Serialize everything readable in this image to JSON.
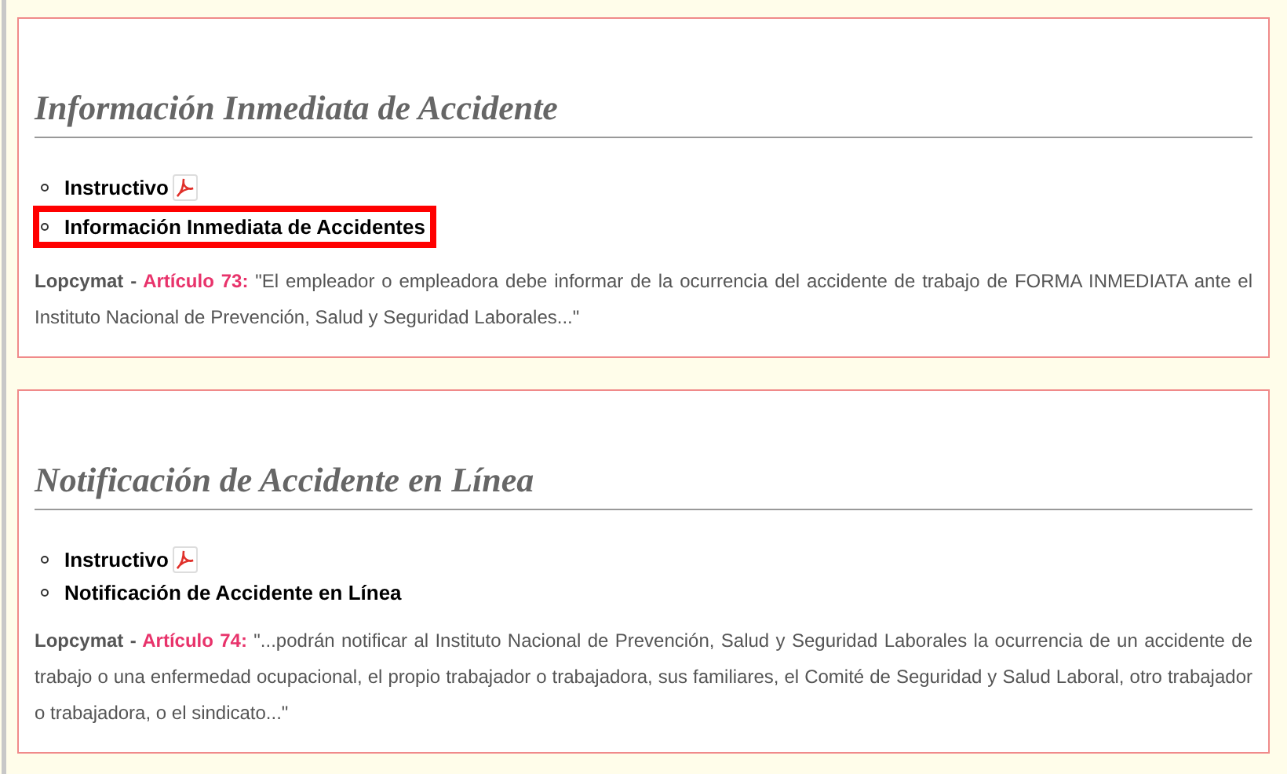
{
  "sections": [
    {
      "title": "Información Inmediata de Accidente",
      "links": [
        {
          "label": "Instructivo",
          "pdf": true,
          "highlighted": false
        },
        {
          "label": "Información Inmediata de Accidentes",
          "pdf": false,
          "highlighted": true
        }
      ],
      "source": "Lopcymat - ",
      "article": "Artículo 73:",
      "quote": " \"El empleador o empleadora debe informar de la ocurrencia del accidente de trabajo de FORMA INMEDIATA ante el Instituto Nacional de Prevención, Salud y Seguridad Laborales...\""
    },
    {
      "title": "Notificación de Accidente en Línea",
      "links": [
        {
          "label": "Instructivo",
          "pdf": true,
          "highlighted": false
        },
        {
          "label": "Notificación de Accidente en Línea",
          "pdf": false,
          "highlighted": false
        }
      ],
      "source": "Lopcymat - ",
      "article": "Artículo 74:",
      "quote": " \"...podrán notificar al Instituto Nacional de Prevención, Salud y Seguridad Laborales la ocurrencia de un accidente de trabajo o una enfermedad ocupacional, el propio trabajador o trabajadora, sus familiares, el Comité de Seguridad y Salud Laboral, otro trabajador o trabajadora, o el sindicato...\""
    }
  ]
}
